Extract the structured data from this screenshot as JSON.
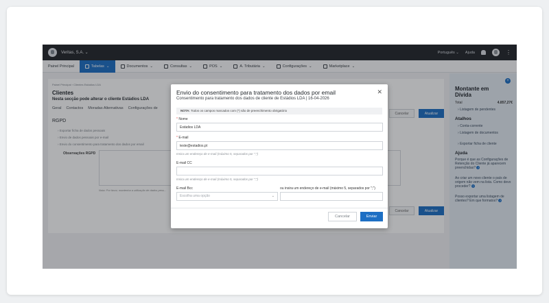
{
  "topbar": {
    "company": "Veritas, S.A.",
    "language": "Português",
    "help": "Ajuda"
  },
  "nav": [
    {
      "label": "Painel Principal",
      "active": false
    },
    {
      "label": "Tabelas",
      "active": true
    },
    {
      "label": "Documentos",
      "active": false
    },
    {
      "label": "Consultas",
      "active": false
    },
    {
      "label": "POS",
      "active": false
    },
    {
      "label": "A. Tributária",
      "active": false
    },
    {
      "label": "Configurações",
      "active": false
    },
    {
      "label": "Marketplace",
      "active": false
    }
  ],
  "page": {
    "breadcrumb": "Painel Principal  ›  Clientes  Estádios LDA",
    "title": "Clientes",
    "subtitle": "Nesta secção pode alterar o cliente Estádios LDA",
    "tabs": [
      "Geral",
      "Contactos",
      "Moradas Alternativas",
      "Configurações de"
    ],
    "section": "RGPD",
    "links": [
      "Exportar ficha de dados pessoais",
      "Envio de dados pessoais por e-mail",
      "Envio do consentimento para tratamento dos dados por email"
    ],
    "obs_label": "Observações RGPD",
    "note": "Nota: Por favor, mantenha a utilização de dados pess...",
    "cancel": "Cancelar",
    "update": "Atualizar"
  },
  "sidebar": {
    "title": "Montante em Dívida",
    "total_label": "Total",
    "total_value": "4.857,27€",
    "pending_link": "Listagem de pendentes",
    "shortcuts_title": "Atalhos",
    "shortcuts": [
      "Conta-corrente",
      "Listagem de documentos",
      "Exportar ficha de cliente"
    ],
    "help_title": "Ajuda",
    "help_items": [
      "Porque é que as Configurações de Retenção do Cliente já aparecem preenchidas?",
      "Ao criar um novo cliente o país de origem não vem na lista. Como devo proceder?",
      "Posso exportar uma listagem de clientes? Em que formatos?"
    ]
  },
  "modal": {
    "title": "Envio do consentimento para tratamento dos dados por email",
    "subtitle": "Consentimento para tratamento dos dados de cliente de Estádios LDA | 16-04-2026",
    "note_bold": "NOTA:",
    "note_text": " Todos os campos marcados com (*) são de preenchimento obrigatório",
    "name_label": "Nome",
    "name_value": "Estádios LDA",
    "email_label": "E-mail",
    "email_value": "teste@estadios.pt",
    "email_hint": "Insira um endereço de e-mail (máximo 5, separados por \";\")",
    "cc_label": "E-mail CC",
    "cc_value": "",
    "cc_hint": "Insira um endereço de e-mail (máximo 5, separados por \";\")",
    "bcc_label": "E-mail Bcc",
    "bcc_placeholder": "Escolha uma opção",
    "bcc_hint": "ou insira um endereço de e-mail (máximo 5, separados por \";\")",
    "cancel": "Cancelar",
    "send": "Enviar"
  }
}
